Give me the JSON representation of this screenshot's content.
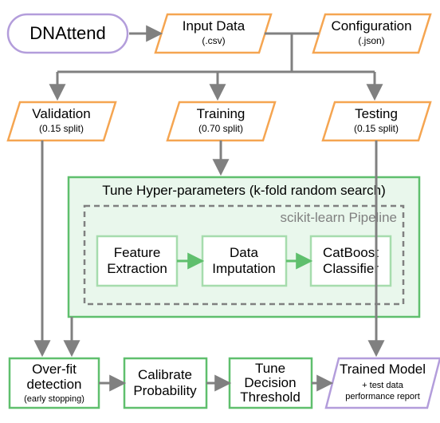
{
  "nodes": {
    "dnattend": {
      "label": "DNAttend"
    },
    "input_data": {
      "label": "Input Data",
      "sub": "(.csv)"
    },
    "configuration": {
      "label": "Configuration",
      "sub": "(.json)"
    },
    "validation": {
      "label": "Validation",
      "sub": "(0.15 split)"
    },
    "training": {
      "label": "Training",
      "sub": "(0.70 split)"
    },
    "testing": {
      "label": "Testing",
      "sub": "(0.15 split)"
    },
    "hyperparams_title": "Tune Hyper-parameters (k-fold random search)",
    "pipeline_label": "scikit-learn Pipeline",
    "feature": {
      "l1": "Feature",
      "l2": "Extraction"
    },
    "imputation": {
      "l1": "Data",
      "l2": "Imputation"
    },
    "catboost": {
      "l1": "CatBoost",
      "l2": "Classifier"
    },
    "overfit": {
      "l1": "Over-fit",
      "l2": "detection",
      "sub": "(early stopping)"
    },
    "calibrate": {
      "l1": "Calibrate",
      "l2": "Probability"
    },
    "tune_thresh": {
      "l1": "Tune",
      "l2": "Decision",
      "l3": "Threshold"
    },
    "trained": {
      "l1": "Trained Model",
      "sub1": "+ test data",
      "sub2": "performance report"
    }
  },
  "chart_data": {
    "type": "diagram",
    "nodes": [
      {
        "id": "dnattend",
        "shape": "rounded",
        "color": "purple",
        "label": "DNAttend"
      },
      {
        "id": "input_data",
        "shape": "parallelogram",
        "color": "orange",
        "label": "Input Data",
        "sub": "(.csv)"
      },
      {
        "id": "configuration",
        "shape": "parallelogram",
        "color": "orange",
        "label": "Configuration",
        "sub": "(.json)"
      },
      {
        "id": "validation",
        "shape": "parallelogram",
        "color": "orange",
        "label": "Validation",
        "sub": "(0.15 split)"
      },
      {
        "id": "training",
        "shape": "parallelogram",
        "color": "orange",
        "label": "Training",
        "sub": "(0.70 split)"
      },
      {
        "id": "testing",
        "shape": "parallelogram",
        "color": "orange",
        "label": "Testing",
        "sub": "(0.15 split)"
      },
      {
        "id": "hyper_group",
        "shape": "group-rect",
        "color": "green",
        "label": "Tune Hyper-parameters (k-fold random search)"
      },
      {
        "id": "pipeline_group",
        "shape": "dashed-rect",
        "color": "gray",
        "label": "scikit-learn Pipeline"
      },
      {
        "id": "feature",
        "shape": "rect",
        "color": "green",
        "label": "Feature Extraction"
      },
      {
        "id": "imputation",
        "shape": "rect",
        "color": "green",
        "label": "Data Imputation"
      },
      {
        "id": "catboost",
        "shape": "rect",
        "color": "green",
        "label": "CatBoost Classifier"
      },
      {
        "id": "overfit",
        "shape": "rect",
        "color": "green",
        "label": "Over-fit detection",
        "sub": "(early stopping)"
      },
      {
        "id": "calibrate",
        "shape": "rect",
        "color": "green",
        "label": "Calibrate Probability"
      },
      {
        "id": "tune_thresh",
        "shape": "rect",
        "color": "green",
        "label": "Tune Decision Threshold"
      },
      {
        "id": "trained",
        "shape": "parallelogram",
        "color": "purple",
        "label": "Trained Model",
        "sub": "+ test data performance report"
      }
    ],
    "edges": [
      {
        "from": "dnattend",
        "to": "input_data"
      },
      {
        "from": "input_data",
        "join": "configuration",
        "style": "T-junction"
      },
      {
        "from": "T-junction",
        "to": "validation"
      },
      {
        "from": "T-junction",
        "to": "training"
      },
      {
        "from": "T-junction",
        "to": "testing"
      },
      {
        "from": "training",
        "to": "hyper_group"
      },
      {
        "from": "feature",
        "to": "imputation"
      },
      {
        "from": "imputation",
        "to": "catboost"
      },
      {
        "from": "validation",
        "to": "overfit"
      },
      {
        "from": "hyper_group",
        "to": "overfit"
      },
      {
        "from": "overfit",
        "to": "calibrate"
      },
      {
        "from": "calibrate",
        "to": "tune_thresh"
      },
      {
        "from": "tune_thresh",
        "to": "trained"
      },
      {
        "from": "testing",
        "to": "trained"
      }
    ]
  }
}
